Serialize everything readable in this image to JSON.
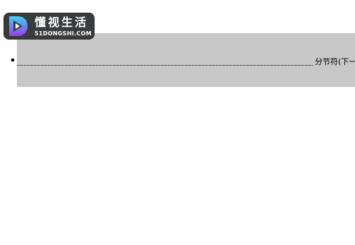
{
  "watermark": {
    "title_cn": "懂视生活",
    "title_en": "51DONGSHI.COM",
    "icon": "play-d-logo-icon",
    "colors": {
      "background": "#3a3b3d",
      "accent_top": "#3fd1f3",
      "accent_bottom": "#9b3ee8"
    }
  },
  "document": {
    "section_break_label": "分节符(下一",
    "band_color": "#c8c8c8"
  }
}
